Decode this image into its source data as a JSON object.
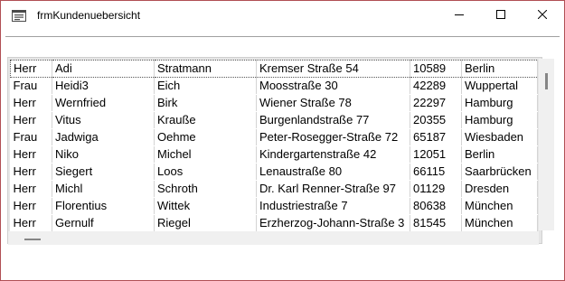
{
  "window": {
    "title": "frmKundenuebersicht",
    "icon": "form-icon",
    "controls": {
      "minimize": "minimize-icon",
      "maximize": "maximize-icon",
      "close": "close-icon"
    }
  },
  "grid": {
    "rows": [
      [
        "Herr",
        "Adi",
        "Stratmann",
        "Kremser Straße 54",
        "10589",
        "Berlin"
      ],
      [
        "Frau",
        "Heidi3",
        "Eich",
        "Moosstraße 30",
        "42289",
        "Wuppertal"
      ],
      [
        "Herr",
        "Wernfried",
        "Birk",
        "Wiener Straße 78",
        "22297",
        "Hamburg"
      ],
      [
        "Herr",
        "Vitus",
        "Krauße",
        "Burgenlandstraße 77",
        "20355",
        "Hamburg"
      ],
      [
        "Frau",
        "Jadwiga",
        "Oehme",
        "Peter-Rosegger-Straße 72",
        "65187",
        "Wiesbaden"
      ],
      [
        "Herr",
        "Niko",
        "Michel",
        "Kindergartenstraße 42",
        "12051",
        "Berlin"
      ],
      [
        "Herr",
        "Siegert",
        "Loos",
        "Lenaustraße 80",
        "66115",
        "Saarbrücken"
      ],
      [
        "Herr",
        "Michl",
        "Schroth",
        "Dr. Karl Renner-Straße 97",
        "01129",
        "Dresden"
      ],
      [
        "Herr",
        "Florentius",
        "Wittek",
        "Industriestraße 7",
        "80638",
        "München"
      ],
      [
        "Herr",
        "Gernulf",
        "Riegel",
        "Erzherzog-Johann-Straße 3",
        "81545",
        "München"
      ]
    ]
  },
  "colors": {
    "frame_border": "#b14f54",
    "grid_background": "#e6e6e6"
  }
}
